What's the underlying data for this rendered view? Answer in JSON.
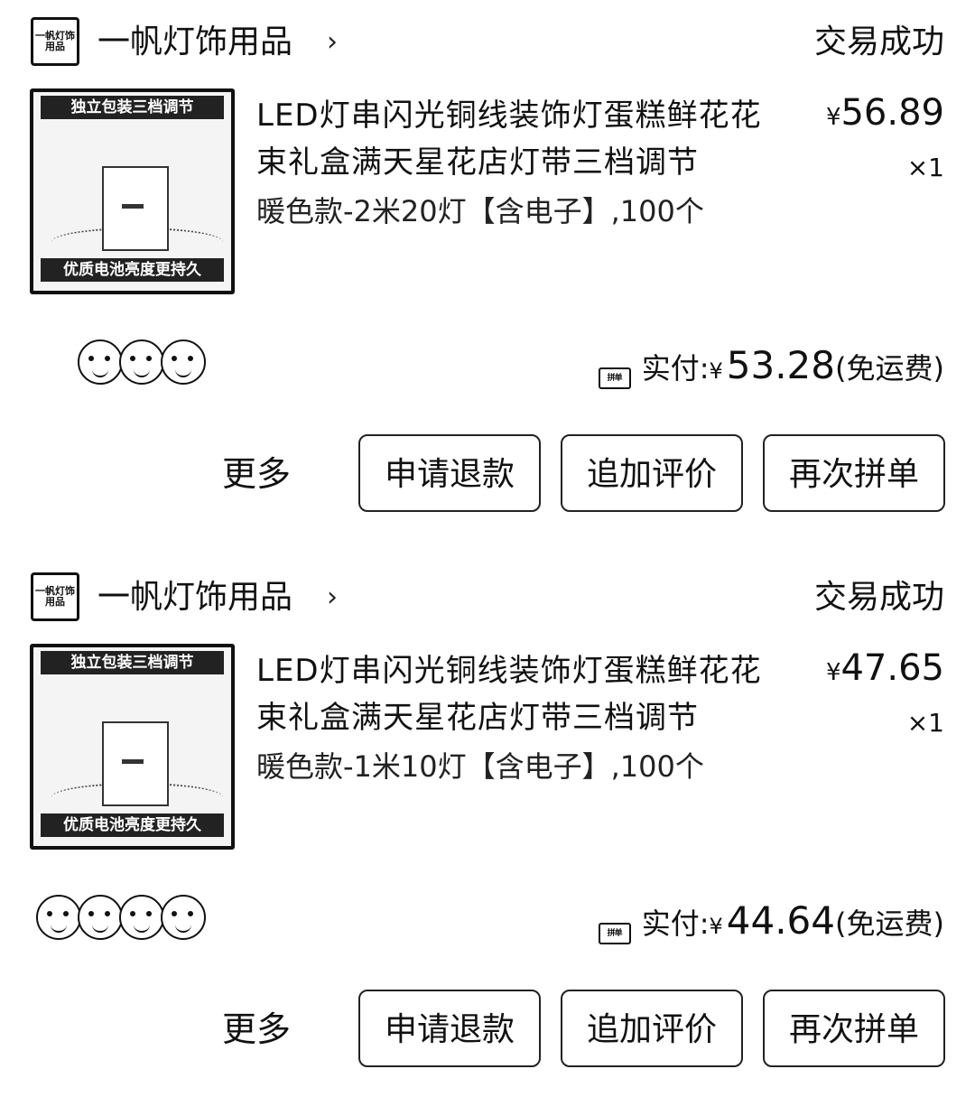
{
  "orders": [
    {
      "shop": {
        "icon_text": "一帆灯饰用品",
        "name": "一帆灯饰用品",
        "chevron": "›"
      },
      "status": "交易成功",
      "product": {
        "thumb_top_text": "独立包装三档调节",
        "thumb_bottom_text": "优质电池亮度更持久",
        "title": "LED灯串闪光铜线装饰灯蛋糕鲜花花束礼盒满天星花店灯带三档调节",
        "spec": "暖色款-2米20灯【含电子】,100个",
        "price": "56.89",
        "qty": "×1"
      },
      "pay": {
        "icon_text": "拼单",
        "label": "实付:",
        "amount": "53.28",
        "shipping": "(免运费)"
      },
      "more_label": "更多",
      "buttons": [
        "申请退款",
        "追加评价",
        "再次拼单"
      ]
    },
    {
      "shop": {
        "icon_text": "一帆灯饰用品",
        "name": "一帆灯饰用品",
        "chevron": "›"
      },
      "status": "交易成功",
      "product": {
        "thumb_top_text": "独立包装三档调节",
        "thumb_bottom_text": "优质电池亮度更持久",
        "title": "LED灯串闪光铜线装饰灯蛋糕鲜花花束礼盒满天星花店灯带三档调节",
        "spec": "暖色款-1米10灯【含电子】,100个",
        "price": "47.65",
        "qty": "×1"
      },
      "pay": {
        "icon_text": "拼单",
        "label": "实付:",
        "amount": "44.64",
        "shipping": "(免运费)"
      },
      "more_label": "更多",
      "buttons": [
        "申请退款",
        "追加评价",
        "再次拼单"
      ]
    }
  ],
  "currency_symbol": "¥"
}
